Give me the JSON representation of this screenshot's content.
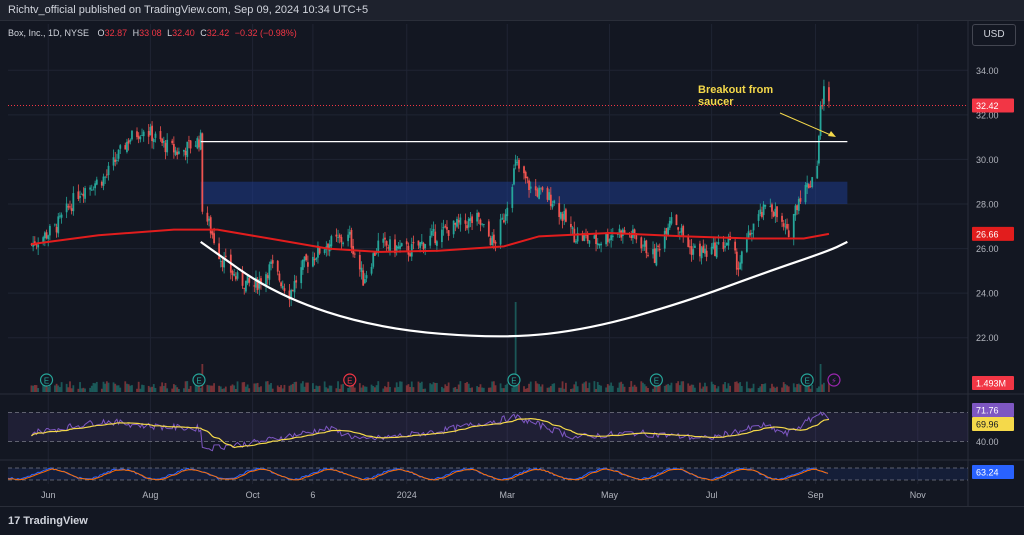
{
  "header": {
    "published_text": "Richtv_official published on TradingView.com, Sep 09, 2024 10:34 UTC+5"
  },
  "legend": {
    "symbol": "Box, Inc., 1D, NYSE",
    "open_label": "O",
    "open": "32.87",
    "high_label": "H",
    "high": "33.08",
    "low_label": "L",
    "low": "32.40",
    "close_label": "C",
    "close": "32.42",
    "change": "−0.32 (−0.98%)"
  },
  "currency": "USD",
  "annotation": {
    "text_line1": "Breakout from",
    "text_line2": "saucer"
  },
  "price_axis": {
    "ticks": [
      "34.00",
      "32.00",
      "30.00",
      "28.00",
      "26.00",
      "24.00",
      "22.00"
    ],
    "last_price_label": "32.42",
    "ma_label": "26.66",
    "volume_label": "1.493M"
  },
  "rsi_axis": {
    "ticks": [
      "80.00",
      "40.00"
    ],
    "rsi_label": "71.76",
    "rsi_ma_label": "69.96"
  },
  "stoch_axis": {
    "stoch_label": "63.24"
  },
  "time_axis": {
    "ticks": [
      "Jun",
      "Aug",
      "Oct",
      "6",
      "2024",
      "Mar",
      "May",
      "Jul",
      "Sep",
      "Nov"
    ]
  },
  "earnings_marker": "E",
  "footer": {
    "brand": "TradingView"
  },
  "colors": {
    "background": "#131722",
    "up": "#26a69a",
    "down": "#ef5350",
    "ma": "#e21d1d",
    "saucer": "#ffffff",
    "zone": "#1e3a8a",
    "annotation": "#f5d94a",
    "rsi": "#7e57c2",
    "rsi_ma": "#f5d94a"
  },
  "chart_data": {
    "type": "candlestick",
    "title": "Box, Inc., 1D, NYSE",
    "ylim": [
      21.0,
      35.0
    ],
    "x_tick_labels": [
      "Jun",
      "Aug",
      "Oct",
      "6",
      "2024",
      "Mar",
      "May",
      "Jul",
      "Sep",
      "Nov"
    ],
    "price_path": [
      [
        "2023-05-22",
        26.2
      ],
      [
        "2023-06-05",
        26.9
      ],
      [
        "2023-06-20",
        28.6
      ],
      [
        "2023-07-05",
        29.2
      ],
      [
        "2023-07-19",
        30.9
      ],
      [
        "2023-07-28",
        31.4
      ],
      [
        "2023-08-08",
        30.7
      ],
      [
        "2023-08-18",
        30.3
      ],
      [
        "2023-08-31",
        30.9
      ],
      [
        "2023-09-01",
        27.9
      ],
      [
        "2023-09-12",
        25.6
      ],
      [
        "2023-09-22",
        24.6
      ],
      [
        "2023-10-02",
        24.3
      ],
      [
        "2023-10-12",
        25.2
      ],
      [
        "2023-10-23",
        24.0
      ],
      [
        "2023-11-01",
        25.3
      ],
      [
        "2023-11-14",
        26.2
      ],
      [
        "2023-11-28",
        26.5
      ],
      [
        "2023-12-06",
        24.6
      ],
      [
        "2023-12-15",
        26.2
      ],
      [
        "2024-01-03",
        25.9
      ],
      [
        "2024-01-16",
        26.5
      ],
      [
        "2024-01-30",
        27.0
      ],
      [
        "2024-02-12",
        27.3
      ],
      [
        "2024-02-22",
        26.2
      ],
      [
        "2024-02-28",
        27.4
      ],
      [
        "2024-03-06",
        29.8
      ],
      [
        "2024-03-15",
        28.7
      ],
      [
        "2024-03-28",
        28.2
      ],
      [
        "2024-04-10",
        26.6
      ],
      [
        "2024-04-24",
        26.3
      ],
      [
        "2024-05-06",
        26.8
      ],
      [
        "2024-05-17",
        26.5
      ],
      [
        "2024-05-28",
        25.6
      ],
      [
        "2024-06-07",
        27.6
      ],
      [
        "2024-06-18",
        26.0
      ],
      [
        "2024-06-28",
        25.8
      ],
      [
        "2024-07-11",
        26.3
      ],
      [
        "2024-07-17",
        25.2
      ],
      [
        "2024-07-26",
        27.1
      ],
      [
        "2024-08-05",
        28.0
      ],
      [
        "2024-08-15",
        26.6
      ],
      [
        "2024-08-22",
        28.3
      ],
      [
        "2024-08-29",
        29.0
      ],
      [
        "2024-09-02",
        29.9
      ],
      [
        "2024-09-04",
        32.2
      ],
      [
        "2024-09-06",
        33.1
      ],
      [
        "2024-09-09",
        32.42
      ]
    ],
    "moving_average": [
      [
        "2023-05-22",
        26.2
      ],
      [
        "2023-07-01",
        26.6
      ],
      [
        "2023-08-15",
        26.85
      ],
      [
        "2023-09-10",
        26.85
      ],
      [
        "2023-10-15",
        26.4
      ],
      [
        "2023-11-15",
        26.0
      ],
      [
        "2023-12-15",
        25.85
      ],
      [
        "2024-01-20",
        25.9
      ],
      [
        "2024-02-28",
        26.1
      ],
      [
        "2024-03-20",
        26.55
      ],
      [
        "2024-05-01",
        26.7
      ],
      [
        "2024-06-15",
        26.55
      ],
      [
        "2024-07-25",
        26.45
      ],
      [
        "2024-08-25",
        26.45
      ],
      [
        "2024-09-09",
        26.66
      ]
    ],
    "saucer_curve": [
      [
        "2023-08-31",
        26.3
      ],
      [
        "2023-10-15",
        23.9
      ],
      [
        "2023-12-15",
        22.4
      ],
      [
        "2024-02-28",
        21.95
      ],
      [
        "2024-04-20",
        22.4
      ],
      [
        "2024-06-15",
        23.6
      ],
      [
        "2024-08-01",
        24.9
      ],
      [
        "2024-09-09",
        25.9
      ],
      [
        "2024-09-20",
        26.3
      ]
    ],
    "resistance_line": {
      "y": 30.8,
      "from": "2023-08-31",
      "to": "2024-09-20"
    },
    "supply_zone": {
      "y_low": 28.0,
      "y_high": 29.0,
      "from": "2023-08-31",
      "to": "2024-09-20"
    },
    "last_price": 32.42,
    "ma_last": 26.66,
    "volume_last": "1.493M",
    "volume_spikes": [
      [
        "2024-03-06",
        "large"
      ],
      [
        "2023-09-01",
        "medium"
      ],
      [
        "2024-09-04",
        "medium"
      ]
    ],
    "earnings_dates": [
      "2023-05-31",
      "2023-08-30",
      "2023-11-28",
      "2024-03-05",
      "2024-05-29",
      "2024-08-27"
    ],
    "rsi": {
      "last": 71.76,
      "ma_last": 69.96,
      "levels": [
        80,
        40
      ],
      "path": [
        [
          "2023-05-22",
          52
        ],
        [
          "2023-07-05",
          68
        ],
        [
          "2023-08-01",
          61
        ],
        [
          "2023-08-31",
          58
        ],
        [
          "2023-09-01",
          30
        ],
        [
          "2023-10-01",
          38
        ],
        [
          "2023-11-15",
          58
        ],
        [
          "2023-12-06",
          42
        ],
        [
          "2024-01-20",
          54
        ],
        [
          "2024-03-06",
          74
        ],
        [
          "2024-04-10",
          46
        ],
        [
          "2024-05-17",
          52
        ],
        [
          "2024-06-28",
          44
        ],
        [
          "2024-08-01",
          62
        ],
        [
          "2024-08-15",
          50
        ],
        [
          "2024-09-06",
          82
        ],
        [
          "2024-09-09",
          71.76
        ]
      ]
    },
    "stochastic": {
      "last": 63.24
    }
  }
}
